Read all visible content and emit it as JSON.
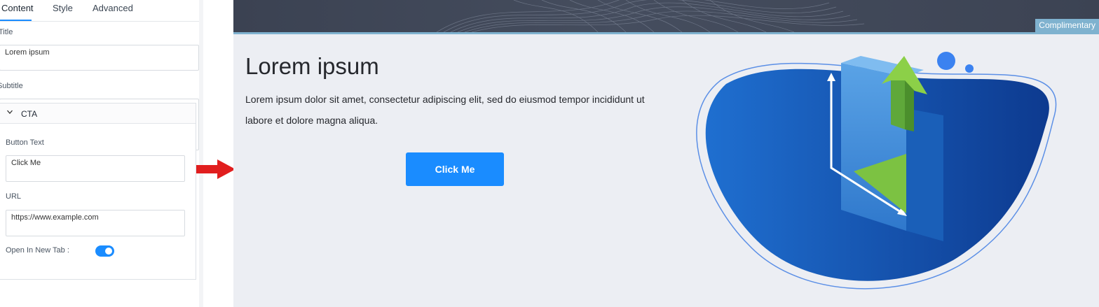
{
  "panel": {
    "tabs": [
      {
        "label": "Content"
      },
      {
        "label": "Style"
      },
      {
        "label": "Advanced"
      }
    ],
    "title_label": "Title",
    "title_value": "Lorem ipsum",
    "subtitle_label": "Subtitle",
    "cta": {
      "section_label": "CTA",
      "button_text_label": "Button Text",
      "button_text_value": "Click Me",
      "url_label": "URL",
      "url_value": "https://www.example.com",
      "new_tab_label": "Open In New Tab",
      "new_tab_sep": ":",
      "new_tab_enabled": true
    }
  },
  "preview": {
    "badge": "Complimentary",
    "title": "Lorem ipsum",
    "body": "Lorem ipsum dolor sit amet, consectetur adipiscing elit, sed do eiusmod tempor incididunt ut labore et dolore magna aliqua.",
    "button_label": "Click Me"
  },
  "colors": {
    "accent": "#1a8cff",
    "arrow": "#e11e1e",
    "preview_bg": "#eceef3",
    "hero_band": "#404858",
    "badge_bg": "#7fb2cf",
    "blob_dark": "#0d3a8f",
    "blob_light": "#1f6fd0",
    "green": "#7cc242"
  },
  "icons": {
    "cta_toggle": "chevron-down-icon",
    "transition": "right-arrow-icon",
    "illustration": "upload-screen-illustration"
  }
}
